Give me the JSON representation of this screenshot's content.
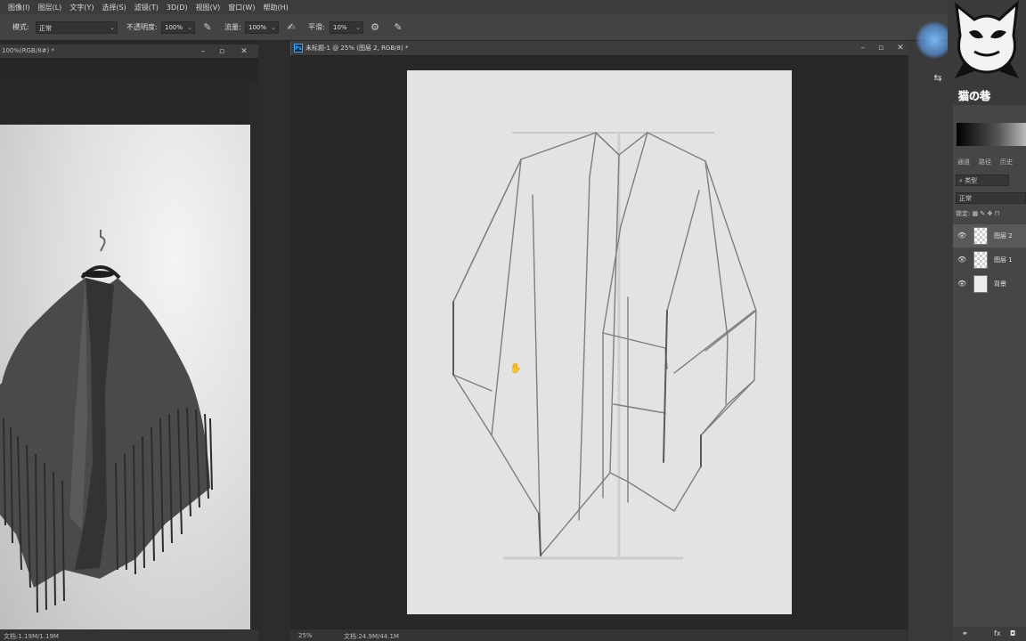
{
  "menu": [
    "图像(I)",
    "图层(L)",
    "文字(Y)",
    "选择(S)",
    "滤镜(T)",
    "3D(D)",
    "视图(V)",
    "窗口(W)",
    "帮助(H)"
  ],
  "options": {
    "mode_label": "模式:",
    "mode_value": "正常",
    "opacity_label": "不透明度:",
    "opacity_value": "100%",
    "flow_label": "流量:",
    "flow_value": "100%",
    "smooth_label": "平滑:",
    "smooth_value": "10%"
  },
  "left_doc": {
    "title": "100%(RGB/8#) *",
    "status": "文档:1.19M/1.19M"
  },
  "main_doc": {
    "title": "未标题-1 @ 25% (图层 2, RGB/8) *",
    "zoom": "25%",
    "doc_size": "文档:24.9M/44.1M"
  },
  "panels": {
    "tabs": [
      "通道",
      "路径",
      "历史"
    ],
    "filter_kind": "类型",
    "blend_mode": "正常",
    "lock_label": "锁定:",
    "layers": [
      {
        "name": "图层 2",
        "active": true,
        "thumb": "checker"
      },
      {
        "name": "图层 1",
        "active": false,
        "thumb": "checker"
      },
      {
        "name": "背景",
        "active": false,
        "thumb": "solid"
      }
    ],
    "bottom_fx": "fx"
  },
  "icons": {
    "brush_pressure": "pressure-icon",
    "airbrush": "airbrush-icon",
    "gear": "gear-icon",
    "eye": "eye-icon",
    "hand_cursor": "hand-cursor-icon"
  }
}
